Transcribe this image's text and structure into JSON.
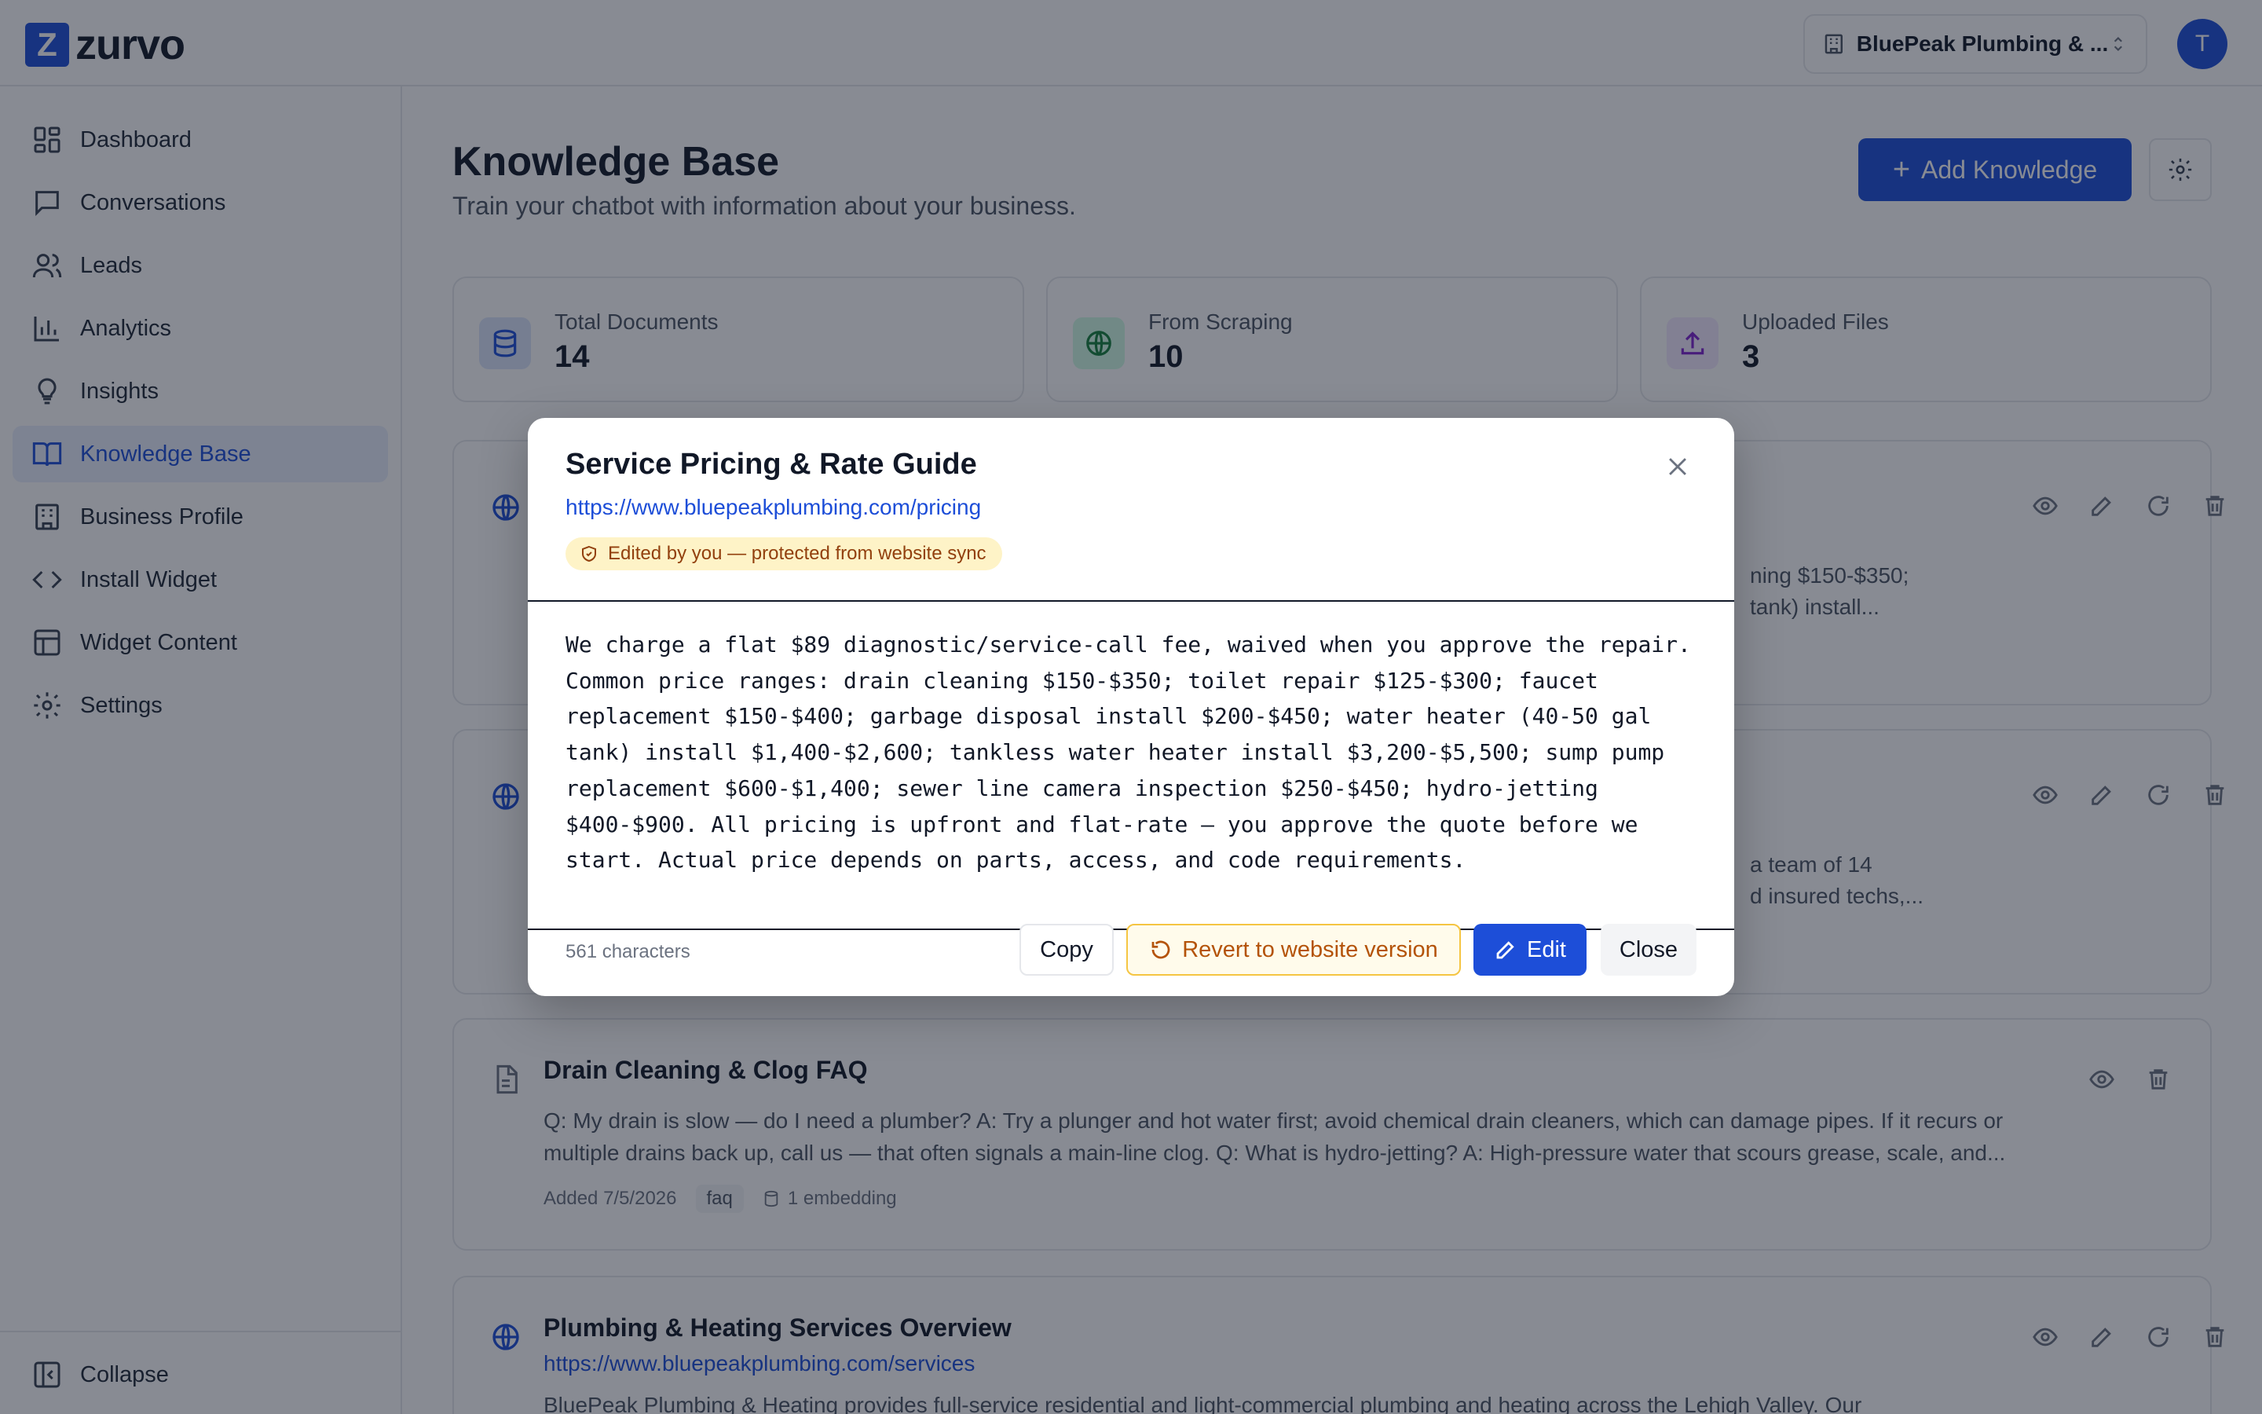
{
  "app": {
    "logo_letter": "Z",
    "logo_name": "zurvo",
    "business": "BluePeak Plumbing & ...",
    "user_initial": "T"
  },
  "sidebar": {
    "items": [
      {
        "label": "Dashboard",
        "icon": "dashboard-icon"
      },
      {
        "label": "Conversations",
        "icon": "message-icon"
      },
      {
        "label": "Leads",
        "icon": "users-icon"
      },
      {
        "label": "Analytics",
        "icon": "bar-chart-icon"
      },
      {
        "label": "Insights",
        "icon": "lightbulb-icon"
      },
      {
        "label": "Knowledge Base",
        "icon": "book-icon",
        "active": true
      },
      {
        "label": "Business Profile",
        "icon": "building-icon"
      },
      {
        "label": "Install Widget",
        "icon": "code-icon"
      },
      {
        "label": "Widget Content",
        "icon": "layout-icon"
      },
      {
        "label": "Settings",
        "icon": "gear-icon"
      }
    ],
    "collapse_label": "Collapse"
  },
  "page": {
    "title": "Knowledge Base",
    "subtitle": "Train your chatbot with information about your business.",
    "add_button": "Add Knowledge"
  },
  "stats": [
    {
      "label": "Total Documents",
      "value": "14",
      "icon": "database-icon"
    },
    {
      "label": "From Scraping",
      "value": "10",
      "icon": "globe-icon"
    },
    {
      "label": "Uploaded Files",
      "value": "3",
      "icon": "upload-icon"
    }
  ],
  "cards": [
    {
      "icon": "globe-icon",
      "desc_line1": "ning $150-$350;",
      "desc_line2": "tank) install..."
    },
    {
      "icon": "globe-icon",
      "desc_line1": "a team of 14",
      "desc_line2": "d insured techs,..."
    },
    {
      "icon": "file-icon",
      "title": "Drain Cleaning & Clog FAQ",
      "desc": "Q: My drain is slow — do I need a plumber? A: Try a plunger and hot water first; avoid chemical drain cleaners, which can damage pipes. If it recurs or multiple drains back up, call us — that often signals a main-line clog. Q: What is hydro-jetting? A: High-pressure water that scours grease, scale, and...",
      "added": "Added 7/5/2026",
      "tag": "faq",
      "embeddings": "1 embedding"
    },
    {
      "icon": "globe-icon",
      "title": "Plumbing & Heating Services Overview",
      "url": "https://www.bluepeakplumbing.com/services",
      "desc": "BluePeak Plumbing & Heating provides full-service residential and light-commercial plumbing and heating across the Lehigh Valley. Our"
    }
  ],
  "modal": {
    "title": "Service Pricing & Rate Guide",
    "url": "https://www.bluepeakplumbing.com/pricing",
    "badge": "Edited by you — protected from website sync",
    "content": "We charge a flat $89 diagnostic/service-call fee, waived when you approve the repair.\nCommon price ranges: drain cleaning $150-$350; toilet repair $125-$300; faucet\nreplacement $150-$400; garbage disposal install $200-$450; water heater (40-50 gal\ntank) install $1,400-$2,600; tankless water heater install $3,200-$5,500; sump pump\nreplacement $600-$1,400; sewer line camera inspection $250-$450; hydro-jetting\n$400-$900. All pricing is upfront and flat-rate — you approve the quote before we\nstart. Actual price depends on parts, access, and code requirements.",
    "char_count": "561 characters",
    "copy_label": "Copy",
    "revert_label": "Revert to website version",
    "edit_label": "Edit",
    "close_label": "Close"
  },
  "colors": {
    "accent": "#1d4ed8",
    "badge_bg": "#fef3c7",
    "badge_text": "#92400e",
    "revert_text": "#b45309"
  }
}
